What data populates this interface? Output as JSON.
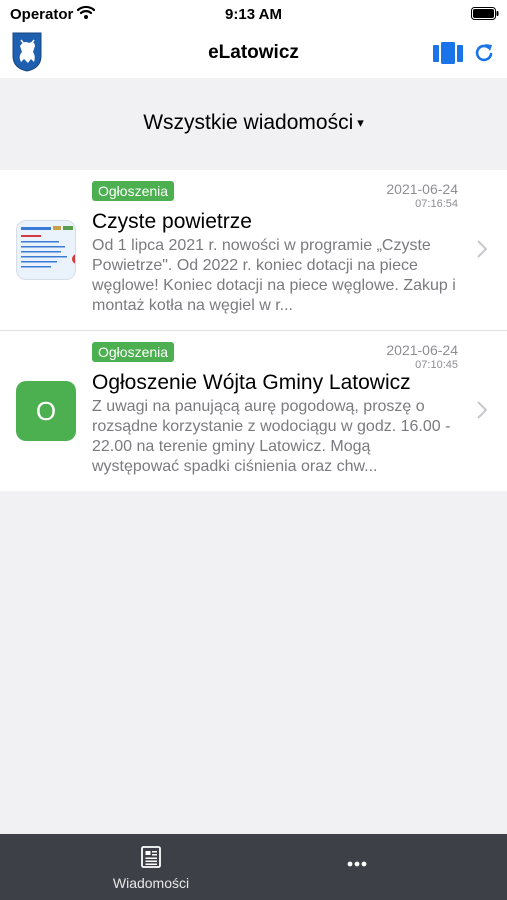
{
  "status_bar": {
    "carrier": "Operator",
    "time": "9:13 AM"
  },
  "nav": {
    "title": "eLatowicz",
    "icons": [
      "crest-icon",
      "book-icon",
      "refresh-icon"
    ],
    "accent_color": "#1a73e8"
  },
  "filter": {
    "label": "Wszystkie wiadomości",
    "arrow": "▾"
  },
  "messages": [
    {
      "category": "Ogłoszenia",
      "date": "2021-06-24",
      "time": "07:16:54",
      "title": "Czyste powietrze",
      "body": "Od 1 lipca 2021 r. nowości w programie „Czyste Powietrze\". Od 2022 r. koniec dotacji na piece węglowe! Koniec dotacji na piece węglowe. Zakup i montaż kotła na węgiel w r...",
      "thumbnail": "image"
    },
    {
      "category": "Ogłoszenia",
      "date": "2021-06-24",
      "time": "07:10:45",
      "title": "Ogłoszenie Wójta Gminy Latowicz",
      "body": "Z uwagi na panującą aurę pogodową, proszę o rozsądne korzystanie z wodociągu w godz. 16.00 - 22.00 na terenie gminy Latowicz. Mogą występować spadki ciśnienia oraz chw...",
      "thumbnail_letter": "O"
    }
  ],
  "tab_bar": {
    "messages_label": "Wiadomości",
    "more_label": "•••"
  },
  "colors": {
    "tag_green": "#4caf50",
    "tab_bar_bg": "#3d4147"
  }
}
